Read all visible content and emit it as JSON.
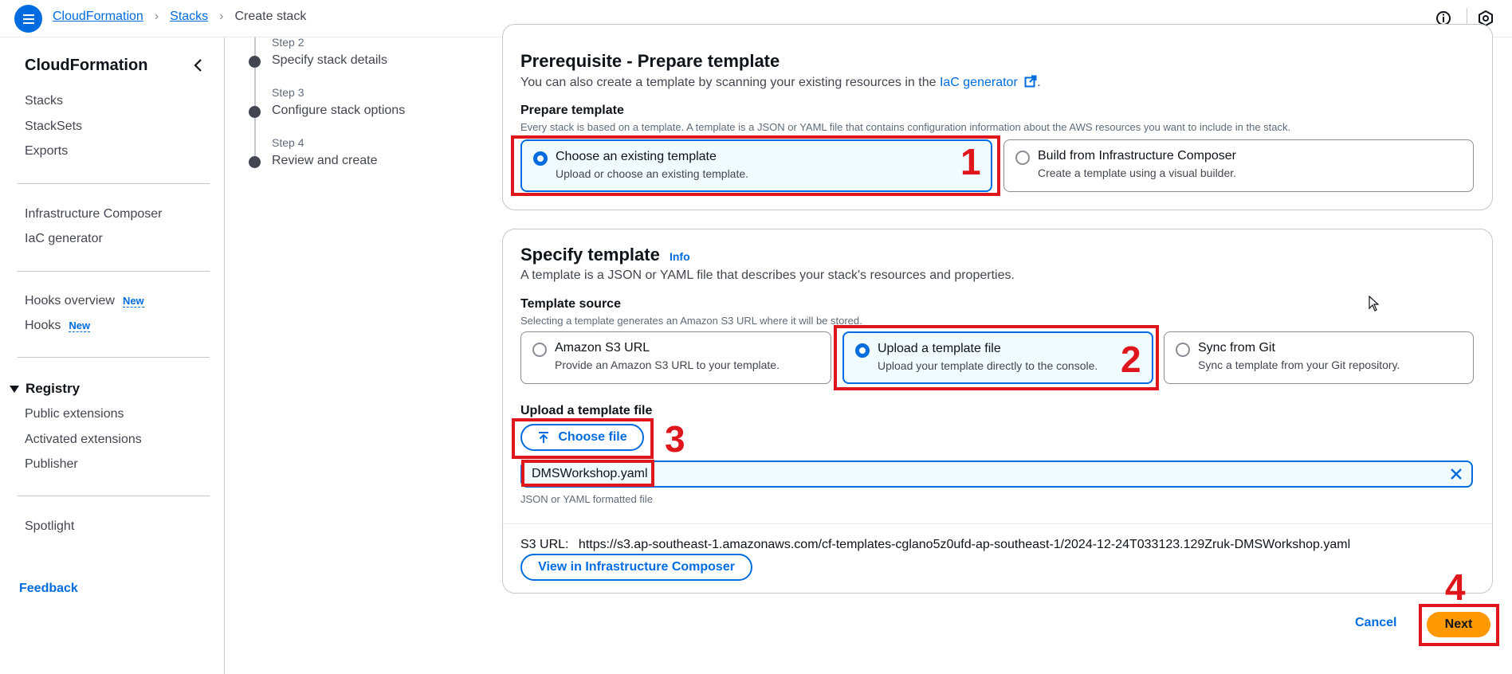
{
  "breadcrumb": {
    "items": [
      "CloudFormation",
      "Stacks"
    ],
    "current": "Create stack"
  },
  "sidebar": {
    "title": "CloudFormation",
    "group1": [
      "Stacks",
      "StackSets",
      "Exports"
    ],
    "group2": [
      "Infrastructure Composer",
      "IaC generator"
    ],
    "group3": [
      {
        "label": "Hooks overview",
        "badge": "New"
      },
      {
        "label": "Hooks",
        "badge": "New"
      }
    ],
    "registry": {
      "label": "Registry",
      "items": [
        "Public extensions",
        "Activated extensions",
        "Publisher"
      ]
    },
    "spotlight": "Spotlight",
    "feedback": "Feedback"
  },
  "steps": [
    {
      "step": "Step 2",
      "label": "Specify stack details"
    },
    {
      "step": "Step 3",
      "label": "Configure stack options"
    },
    {
      "step": "Step 4",
      "label": "Review and create"
    }
  ],
  "prerequisite": {
    "title": "Prerequisite - Prepare template",
    "desc_prefix": "You can also create a template by scanning your existing resources in the ",
    "desc_link": "IaC generator",
    "desc_suffix": ".",
    "field_label": "Prepare template",
    "field_desc": "Every stack is based on a template. A template is a JSON or YAML file that contains configuration information about the AWS resources you want to include in the stack.",
    "options": [
      {
        "title": "Choose an existing template",
        "desc": "Upload or choose an existing template.",
        "selected": true
      },
      {
        "title": "Build from Infrastructure Composer",
        "desc": "Create a template using a visual builder.",
        "selected": false
      }
    ]
  },
  "specify": {
    "title": "Specify template",
    "info": "Info",
    "desc": "A template is a JSON or YAML file that describes your stack's resources and properties.",
    "source_label": "Template source",
    "source_desc": "Selecting a template generates an Amazon S3 URL where it will be stored.",
    "options": [
      {
        "title": "Amazon S3 URL",
        "desc": "Provide an Amazon S3 URL to your template.",
        "selected": false
      },
      {
        "title": "Upload a template file",
        "desc": "Upload your template directly to the console.",
        "selected": true
      },
      {
        "title": "Sync from Git",
        "desc": "Sync a template from your Git repository.",
        "selected": false
      }
    ],
    "upload_label": "Upload a template file",
    "choose_file": "Choose file",
    "file_name": "DMSWorkshop.yaml",
    "file_hint": "JSON or YAML formatted file",
    "s3_label": "S3 URL:",
    "s3_url": "https://s3.ap-southeast-1.amazonaws.com/cf-templates-cglano5z0ufd-ap-southeast-1/2024-12-24T033123.129Zruk-DMSWorkshop.yaml",
    "view_button": "View in Infrastructure Composer"
  },
  "actions": {
    "cancel": "Cancel",
    "next": "Next"
  },
  "annotations": [
    "1",
    "2",
    "3",
    "4"
  ],
  "colors": {
    "accent": "#006ce0",
    "primary_button": "#ff9900",
    "annotation": "#e0161d"
  }
}
